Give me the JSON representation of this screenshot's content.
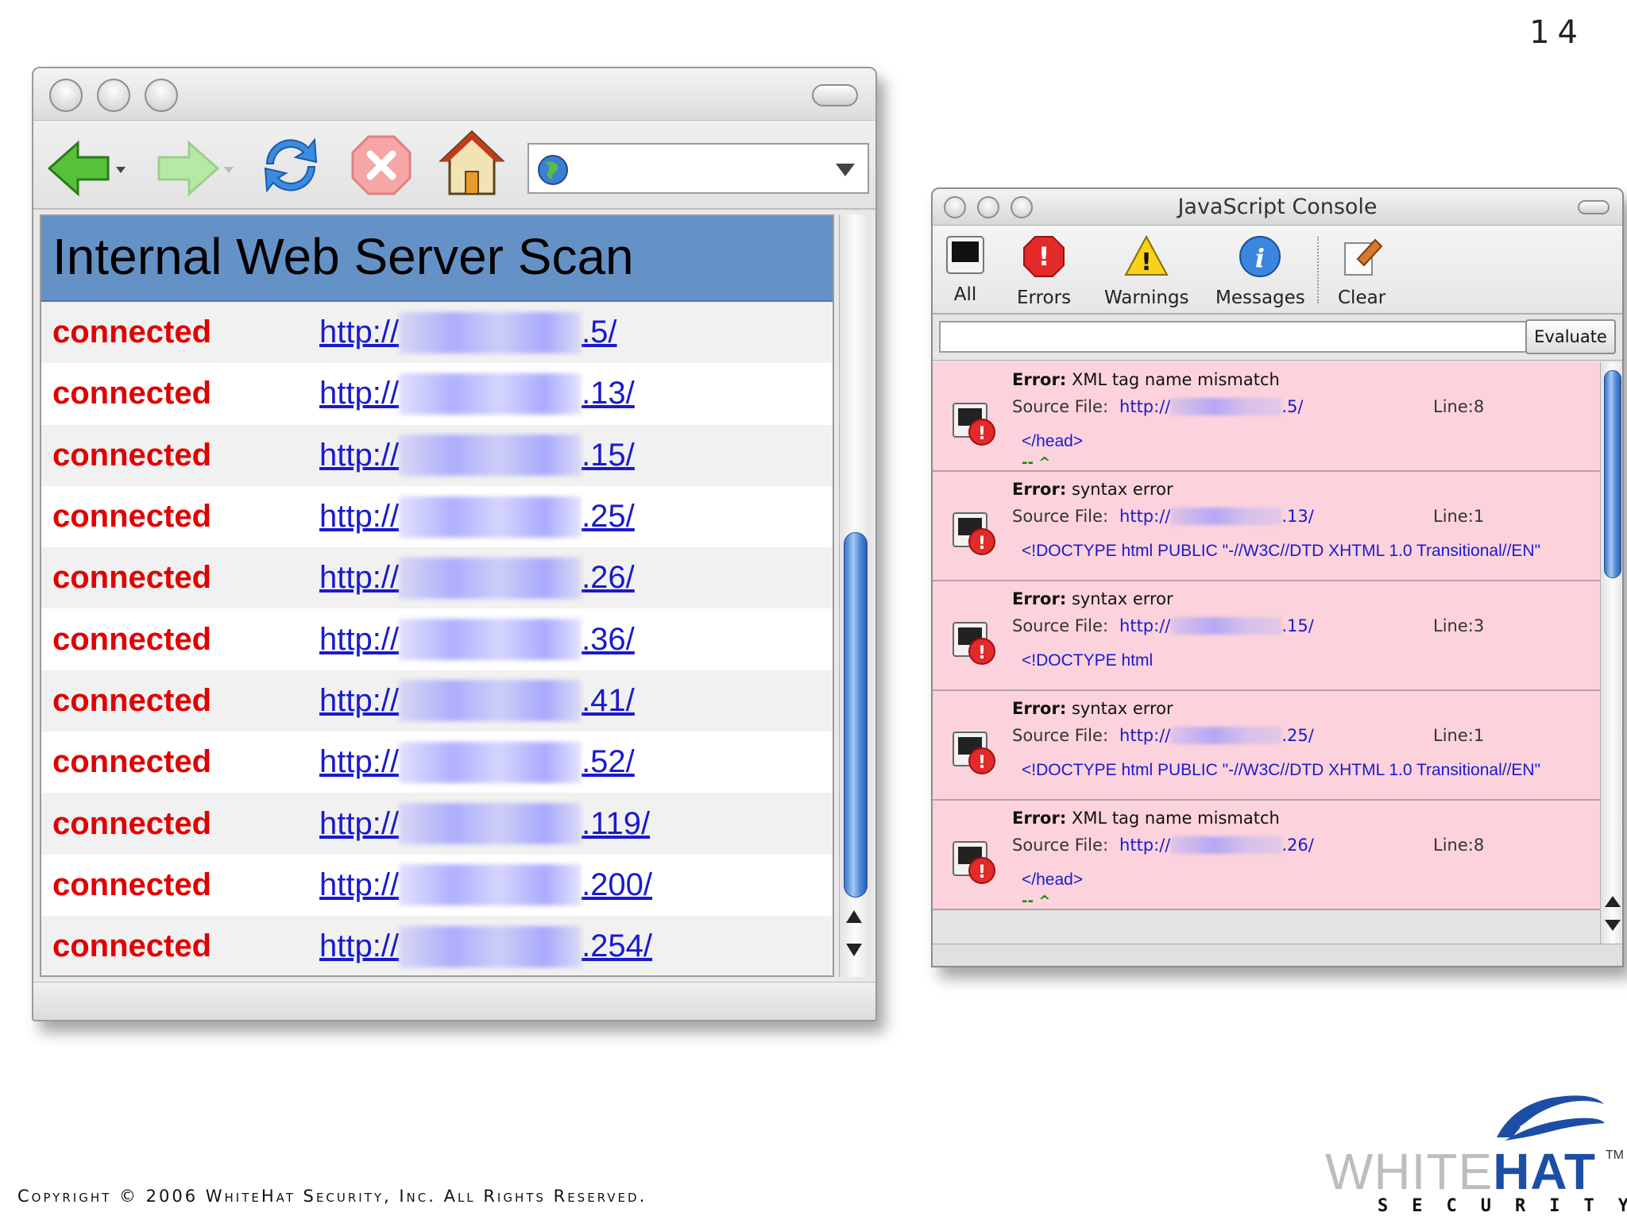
{
  "slide_number": "14",
  "browser": {
    "page_title": "Internal Web Server Scan",
    "url_value": "",
    "rows": [
      {
        "status": "connected",
        "url_prefix": "http://",
        "url_suffix": ".5/"
      },
      {
        "status": "connected",
        "url_prefix": "http://",
        "url_suffix": ".13/"
      },
      {
        "status": "connected",
        "url_prefix": "http://",
        "url_suffix": ".15/"
      },
      {
        "status": "connected",
        "url_prefix": "http://",
        "url_suffix": ".25/"
      },
      {
        "status": "connected",
        "url_prefix": "http://",
        "url_suffix": ".26/"
      },
      {
        "status": "connected",
        "url_prefix": "http://",
        "url_suffix": ".36/"
      },
      {
        "status": "connected",
        "url_prefix": "http://",
        "url_suffix": ".41/"
      },
      {
        "status": "connected",
        "url_prefix": "http://",
        "url_suffix": ".52/"
      },
      {
        "status": "connected",
        "url_prefix": "http://",
        "url_suffix": ".119/"
      },
      {
        "status": "connected",
        "url_prefix": "http://",
        "url_suffix": ".200/"
      },
      {
        "status": "connected",
        "url_prefix": "http://",
        "url_suffix": ".254/"
      }
    ]
  },
  "console": {
    "title": "JavaScript Console",
    "toolbar": {
      "all": "All",
      "errors": "Errors",
      "warnings": "Warnings",
      "messages": "Messages",
      "clear": "Clear"
    },
    "evaluate_label": "Evaluate",
    "source_label": "Source File:",
    "entries": [
      {
        "error_label": "Error:",
        "message": "XML tag name mismatch",
        "url_prefix": "http://",
        "url_suffix": ".5/",
        "line": "Line:8",
        "code": "</head>",
        "caret": "-- ^"
      },
      {
        "error_label": "Error:",
        "message": "syntax error",
        "url_prefix": "http://",
        "url_suffix": ".13/",
        "line": "Line:1",
        "code": "<!DOCTYPE html PUBLIC \"-//W3C//DTD XHTML 1.0 Transitional//EN\"",
        "caret": ""
      },
      {
        "error_label": "Error:",
        "message": "syntax error",
        "url_prefix": "http://",
        "url_suffix": ".15/",
        "line": "Line:3",
        "code": "<!DOCTYPE html",
        "caret": ""
      },
      {
        "error_label": "Error:",
        "message": "syntax error",
        "url_prefix": "http://",
        "url_suffix": ".25/",
        "line": "Line:1",
        "code": "<!DOCTYPE html PUBLIC \"-//W3C//DTD XHTML 1.0 Transitional//EN\"",
        "caret": ""
      },
      {
        "error_label": "Error:",
        "message": "XML tag name mismatch",
        "url_prefix": "http://",
        "url_suffix": ".26/",
        "line": "Line:8",
        "code": "</head>",
        "caret": "-- ^"
      }
    ]
  },
  "footer": {
    "copyright": "Copyright © 2006 WhiteHat Security, Inc. All Rights Reserved.",
    "logo_white": "WHITE",
    "logo_hat": "HAT",
    "logo_tm": "TM",
    "logo_security": "SECURITY"
  },
  "colors": {
    "connected": "#e00000",
    "link": "#1a1acc",
    "header_bar": "#6592c6",
    "error_bg": "#fcd3dc",
    "brand_blue": "#1d4ea6"
  }
}
